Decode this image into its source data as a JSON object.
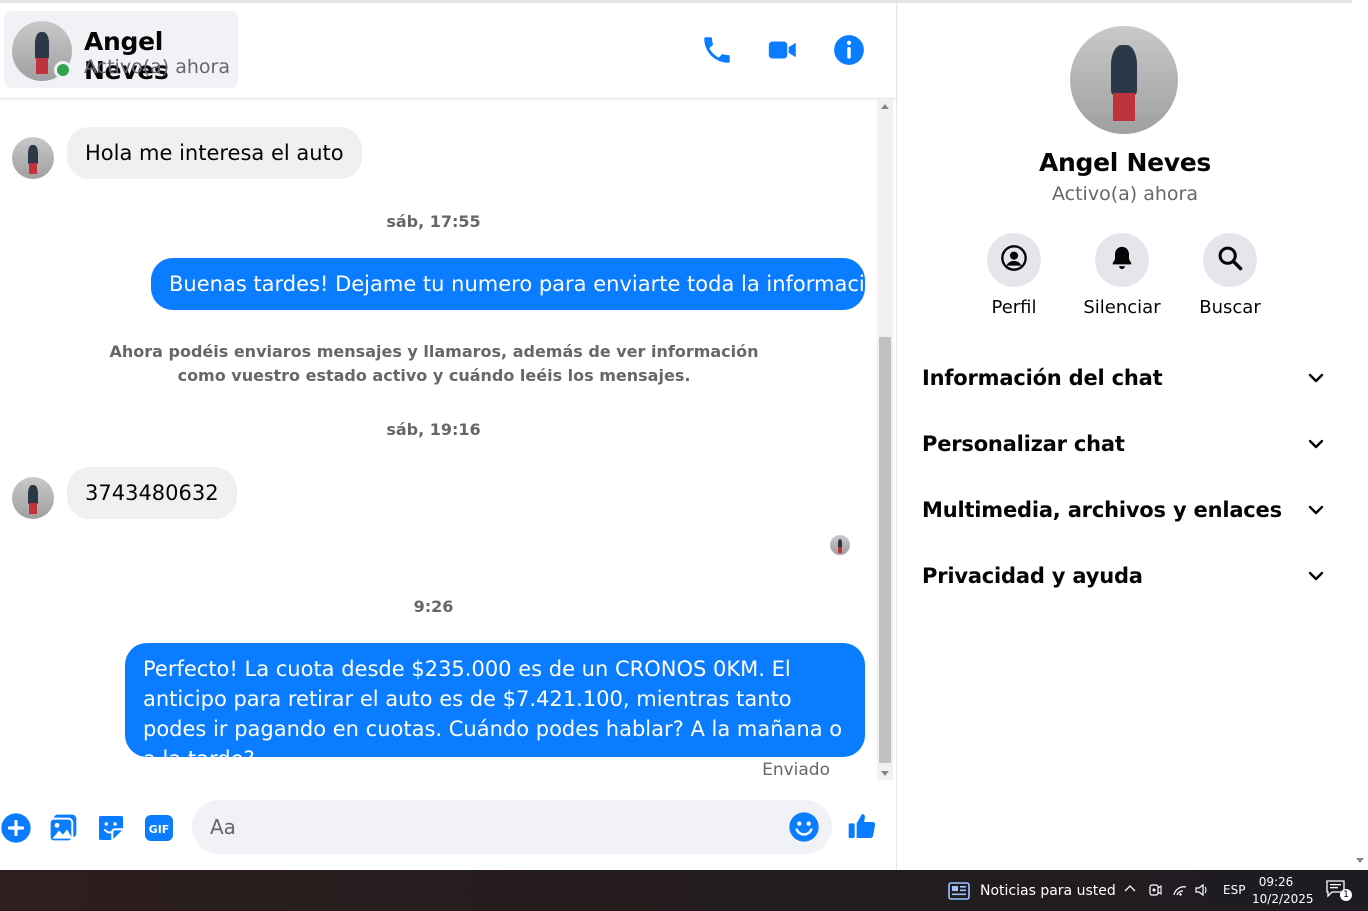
{
  "header": {
    "name": "Angel Neves",
    "status": "Activo(a) ahora",
    "icons": [
      "phone-icon",
      "video-camera-icon",
      "info-icon"
    ]
  },
  "messages": [
    {
      "type": "incoming",
      "text": "Hola me interesa el auto"
    },
    {
      "type": "timestamp",
      "text": "sáb, 17:55"
    },
    {
      "type": "outgoing",
      "text": "Buenas tardes! Dejame tu numero para enviarte toda la informacion."
    },
    {
      "type": "system",
      "text": "Ahora podéis enviaros mensajes y llamaros, además de ver información como vuestro estado activo y cuándo leéis los mensajes."
    },
    {
      "type": "timestamp",
      "text": "sáb, 19:16"
    },
    {
      "type": "incoming",
      "text": "3743480632"
    },
    {
      "type": "timestamp",
      "text": "9:26"
    },
    {
      "type": "outgoing",
      "text": "Perfecto! La cuota desde $235.000 es de un CRONOS 0KM. El anticipo para retirar el auto es de $7.421.100, mientras tanto podes ir pagando en cuotas. Cuándo podes hablar? A la mañana o a la tarde?"
    }
  ],
  "sent_label": "Enviado",
  "composer": {
    "placeholder": "Aa",
    "icons": [
      "plus-icon",
      "image-icon",
      "sticker-icon",
      "gif-icon",
      "emoji-icon",
      "like-icon"
    ],
    "gif_label": "GIF"
  },
  "panel": {
    "name": "Angel Neves",
    "status": "Activo(a) ahora",
    "actions": [
      {
        "label": "Perfil",
        "icon": "profile-icon"
      },
      {
        "label": "Silenciar",
        "icon": "bell-icon"
      },
      {
        "label": "Buscar",
        "icon": "search-icon"
      }
    ],
    "sections": [
      "Información del chat",
      "Personalizar chat",
      "Multimedia, archivos y enlaces",
      "Privacidad y ayuda"
    ]
  },
  "taskbar": {
    "news": "Noticias para usted",
    "lang": "ESP",
    "time": "09:26",
    "date": "10/2/2025",
    "notifications": "1"
  },
  "colors": {
    "accent": "#0a7cff",
    "online": "#31a24c"
  }
}
